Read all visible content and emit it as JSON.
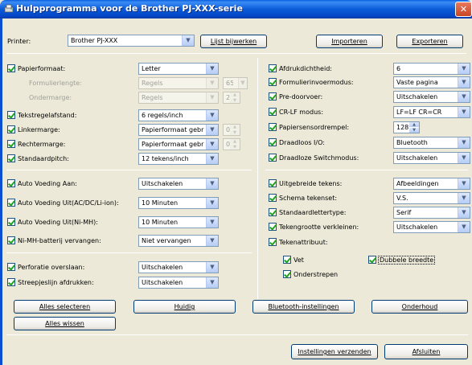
{
  "window": {
    "title": "Hulpprogramma voor de Brother PJ-XXX-serie",
    "close": "✕"
  },
  "printer": {
    "label": "Printer:",
    "value": "Brother PJ-XXX"
  },
  "top_buttons": {
    "update_list": "Lijst bijwerken",
    "import": "Importeren",
    "export": "Exporteren"
  },
  "left": {
    "paper_format": {
      "label": "Papierformaat:",
      "value": "Letter"
    },
    "form_length": {
      "label": "Formulierlengte:",
      "value": "Regels",
      "spin": "65"
    },
    "bottom_margin": {
      "label": "Ondermarge:",
      "value": "Regels",
      "spin": "2"
    },
    "line_spacing": {
      "label": "Tekstregelafstand:",
      "value": "6 regels/inch"
    },
    "left_margin": {
      "label": "Linkermarge:",
      "value": "Papierformaat gebruike",
      "spin": "0"
    },
    "right_margin": {
      "label": "Rechtermarge:",
      "value": "Papierformaat gebruike",
      "spin": "0"
    },
    "default_pitch": {
      "label": "Standaardpitch:",
      "value": "12 tekens/inch"
    },
    "auto_power_on": {
      "label": "Auto Voeding Aan:",
      "value": "Uitschakelen"
    },
    "auto_power_off_ac": {
      "label": "Auto Voeding Uit(AC/DC/Li-ion):",
      "value": "10 Minuten"
    },
    "auto_power_off_nimh": {
      "label": "Auto Voeding Uit(Ni-MH):",
      "value": "10 Minuten"
    },
    "nimh_replace": {
      "label": "Ni-MH-batterij vervangen:",
      "value": "Niet vervangen"
    },
    "perforation_skip": {
      "label": "Perforatie overslaan:",
      "value": "Uitschakelen"
    },
    "dash_print": {
      "label": "Streepjeslijn afdrukken:",
      "value": "Uitschakelen"
    }
  },
  "right": {
    "print_density": {
      "label": "Afdrukdichtheid:",
      "value": "6"
    },
    "form_feed_mode": {
      "label": "Formulierinvoermodus:",
      "value": "Vaste pagina"
    },
    "pre_feed": {
      "label": "Pre-doorvoer:",
      "value": "Uitschakelen"
    },
    "crlf_mode": {
      "label": "CR-LF modus:",
      "value": "LF=LF CR=CR"
    },
    "paper_sensor": {
      "label": "Papiersensordrempel:",
      "value": "128"
    },
    "wireless_io": {
      "label": "Draadloos I/O:",
      "value": "Bluetooth"
    },
    "wireless_switch": {
      "label": "Draadloze Switchmodus:",
      "value": "Uitschakelen"
    },
    "extended_chars": {
      "label": "Uitgebreide tekens:",
      "value": "Afbeeldingen"
    },
    "charset_scheme": {
      "label": "Schema tekenset:",
      "value": "V.S."
    },
    "default_font": {
      "label": "Standaardlettertype:",
      "value": "Serif"
    },
    "char_size_reduce": {
      "label": "Tekengrootte verkleinen:",
      "value": "Uitschakelen"
    },
    "char_attr": {
      "label": "Tekenattribuut:",
      "bold": "Vet",
      "double_width": "Dubbele breedte",
      "underline": "Onderstrepen"
    }
  },
  "bottom_buttons": {
    "select_all": "Alles selecteren",
    "current": "Huidig",
    "bluetooth": "Bluetooth-instellingen",
    "maintenance": "Onderhoud",
    "clear_all": "Alles wissen",
    "send_settings": "Instellingen verzenden",
    "close": "Afsluiten"
  },
  "colors": {
    "titlebar": "#0a5fde",
    "window_bg": "#ece9d8",
    "check": "#21a121"
  }
}
